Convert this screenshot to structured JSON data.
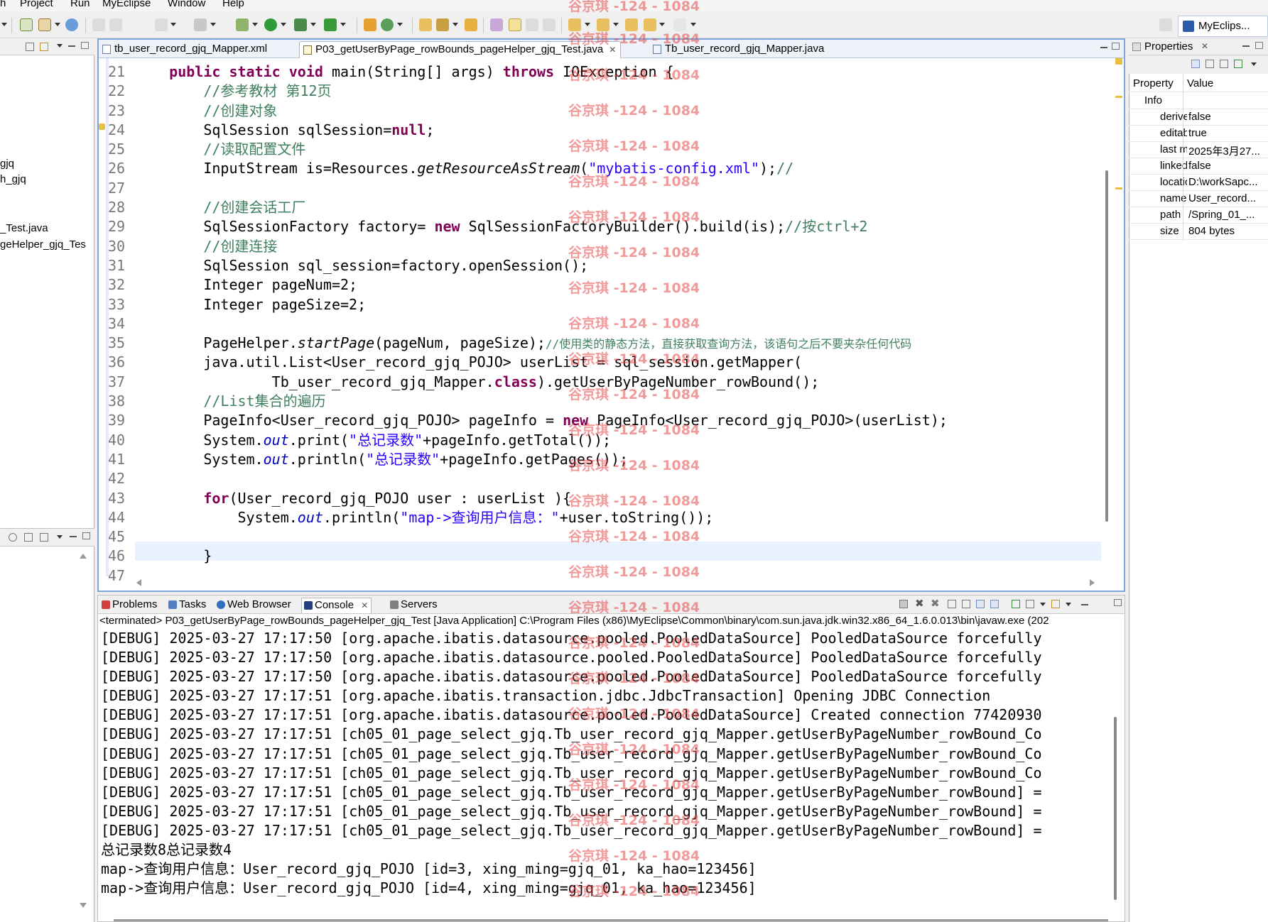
{
  "menu": [
    "h",
    "Project",
    "Run",
    "MyEclipse",
    "Window",
    "Help"
  ],
  "perspective_label": "MyEclips...",
  "left_tree": [
    "gjq",
    "h_gjq",
    "_Test.java",
    "geHelper_gjq_Tes"
  ],
  "editor_tabs": [
    {
      "label": "tb_user_record_gjq_Mapper.xml",
      "close": ""
    },
    {
      "label": "P03_getUserByPage_rowBounds_pageHelper_gjq_Test.java",
      "close": "✕"
    },
    {
      "label": "Tb_user_record_gjq_Mapper.java",
      "close": ""
    }
  ],
  "line_numbers": [
    "21",
    "22",
    "23",
    "24",
    "25",
    "26",
    "27",
    "28",
    "29",
    "30",
    "31",
    "32",
    "33",
    "34",
    "35",
    "36",
    "37",
    "38",
    "39",
    "40",
    "41",
    "42",
    "43",
    "44",
    "45",
    "46",
    "47"
  ],
  "code": {
    "l21_a": "    ",
    "l21_kw1": "public static void",
    "l21_b": " main(String[] args) ",
    "l21_kw2": "throws",
    "l21_c": " IOException {",
    "l22": "        //参考教材 第12页",
    "l23": "        //创建对象",
    "l24_a": "        SqlSession sqlSession=",
    "l24_kw": "null",
    "l24_b": ";",
    "l25": "        //读取配置文件",
    "l26_a": "        InputStream is=Resources.",
    "l26_it": "getResourceAsStream",
    "l26_b": "(",
    "l26_st": "\"mybatis-config.xml\"",
    "l26_c": ");",
    "l26_cm": "//",
    "l28": "        //创建会话工厂",
    "l29_a": "        SqlSessionFactory factory= ",
    "l29_kw": "new",
    "l29_b": " SqlSessionFactoryBuilder().build(is);",
    "l29_cm": "//按ctrl+2",
    "l30": "        //创建连接",
    "l31": "        SqlSession sql_session=factory.openSession();",
    "l32": "        Integer pageNum=2;",
    "l33": "        Integer pageSize=2;",
    "l35_a": "        PageHelper.",
    "l35_it": "startPage",
    "l35_b": "(pageNum, pageSize);",
    "l35_cm": "//使用类的静态方法，直接获取查询方法，该语句之后不要夹杂任何代码",
    "l36": "        java.util.List<User_record_gjq_POJO> userList = sql_session.getMapper(",
    "l37_a": "                Tb_user_record_gjq_Mapper.",
    "l37_kw": "class",
    "l37_b": ").getUserByPageNumber_rowBound();",
    "l38": "        //List集合的遍历",
    "l39_a": "        PageInfo<User_record_gjq_POJO> pageInfo = ",
    "l39_kw": "new",
    "l39_b": " PageInfo<User_record_gjq_POJO>(userList);",
    "l40_a": "        System.",
    "l40_fd": "out",
    "l40_b": ".print(",
    "l40_st": "\"总记录数\"",
    "l40_c": "+pageInfo.getTotal());",
    "l41_a": "        System.",
    "l41_fd": "out",
    "l41_b": ".println(",
    "l41_st": "\"总记录数\"",
    "l41_c": "+pageInfo.getPages());",
    "l43_a": "        ",
    "l43_kw": "for",
    "l43_b": "(User_record_gjq_POJO user : userList ){",
    "l44_a": "            System.",
    "l44_fd": "out",
    "l44_b": ".println(",
    "l44_st": "\"map->查询用户信息：\"",
    "l44_c": "+user.toString());",
    "l46": "        }"
  },
  "console_tabs": [
    {
      "label": "Problems",
      "color": "#d04040"
    },
    {
      "label": "Tasks",
      "color": "#5080c0"
    },
    {
      "label": "Web Browser",
      "color": "#3070c0"
    },
    {
      "label": "Console",
      "color": "#204080",
      "close": "✕"
    },
    {
      "label": "Servers",
      "color": "#808080"
    }
  ],
  "console_status": "<terminated> P03_getUserByPage_rowBounds_pageHelper_gjq_Test [Java Application] C:\\Program Files (x86)\\MyEclipse\\Common\\binary\\com.sun.java.jdk.win32.x86_64_1.6.0.013\\bin\\javaw.exe (202",
  "console_lines": [
    "[DEBUG] 2025-03-27 17:17:50 [org.apache.ibatis.datasource.pooled.PooledDataSource] PooledDataSource forcefully",
    "[DEBUG] 2025-03-27 17:17:50 [org.apache.ibatis.datasource.pooled.PooledDataSource] PooledDataSource forcefully",
    "[DEBUG] 2025-03-27 17:17:50 [org.apache.ibatis.datasource.pooled.PooledDataSource] PooledDataSource forcefully",
    "[DEBUG] 2025-03-27 17:17:51 [org.apache.ibatis.transaction.jdbc.JdbcTransaction] Opening JDBC Connection",
    "[DEBUG] 2025-03-27 17:17:51 [org.apache.ibatis.datasource.pooled.PooledDataSource] Created connection 77420930",
    "[DEBUG] 2025-03-27 17:17:51 [ch05_01_page_select_gjq.Tb_user_record_gjq_Mapper.getUserByPageNumber_rowBound_Co",
    "[DEBUG] 2025-03-27 17:17:51 [ch05_01_page_select_gjq.Tb_user_record_gjq_Mapper.getUserByPageNumber_rowBound_Co",
    "[DEBUG] 2025-03-27 17:17:51 [ch05_01_page_select_gjq.Tb_user_record_gjq_Mapper.getUserByPageNumber_rowBound_Co",
    "[DEBUG] 2025-03-27 17:17:51 [ch05_01_page_select_gjq.Tb_user_record_gjq_Mapper.getUserByPageNumber_rowBound] =",
    "[DEBUG] 2025-03-27 17:17:51 [ch05_01_page_select_gjq.Tb_user_record_gjq_Mapper.getUserByPageNumber_rowBound] =",
    "[DEBUG] 2025-03-27 17:17:51 [ch05_01_page_select_gjq.Tb_user_record_gjq_Mapper.getUserByPageNumber_rowBound] =",
    "总记录数8总记录数4",
    "map->查询用户信息：User_record_gjq_POJO [id=3, xing_ming=gjq_01, ka_hao=123456]",
    "map->查询用户信息：User_record_gjq_POJO [id=4, xing_ming=gjq_01, ka_hao=123456]"
  ],
  "properties": {
    "title": "Properties",
    "close": "✕",
    "col_property": "Property",
    "col_value": "Value",
    "group": "Info",
    "rows": [
      {
        "k": "derived",
        "v": "false"
      },
      {
        "k": "editable",
        "v": "true"
      },
      {
        "k": "last modified",
        "v": "2025年3月27..."
      },
      {
        "k": "linked",
        "v": "false"
      },
      {
        "k": "location",
        "v": "D:\\workSapc..."
      },
      {
        "k": "name",
        "v": "User_record..."
      },
      {
        "k": "path",
        "v": "/Spring_01_..."
      },
      {
        "k": "size",
        "v": "804  bytes"
      }
    ]
  },
  "watermark": "谷京琪 -124 - 1084"
}
